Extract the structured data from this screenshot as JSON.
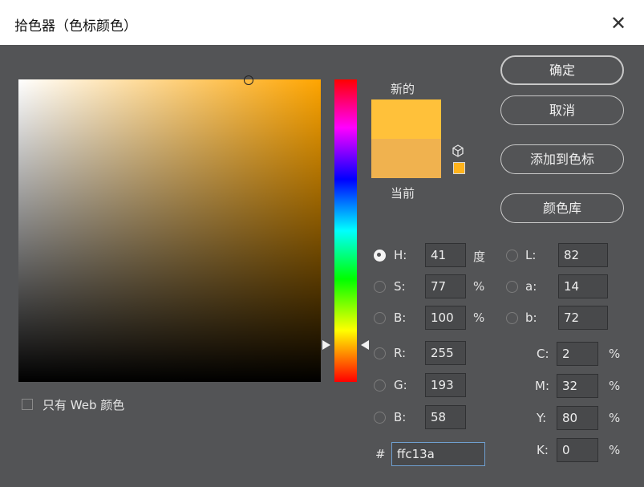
{
  "window": {
    "title": "拾色器（色标颜色）",
    "close_glyph": "✕"
  },
  "swatch": {
    "new_label": "新的",
    "current_label": "当前",
    "new_color": "#ffc13a",
    "current_color": "#f0b24f",
    "web_safe_color": "#ffb31c",
    "icon": "cube-icon"
  },
  "buttons": {
    "ok": "确定",
    "cancel": "取消",
    "add_to_swatches": "添加到色标",
    "color_libraries": "颜色库"
  },
  "hsb": [
    {
      "label": "H:",
      "value": "41",
      "unit": "度",
      "selected": true
    },
    {
      "label": "S:",
      "value": "77",
      "unit": "%",
      "selected": false
    },
    {
      "label": "B:",
      "value": "100",
      "unit": "%",
      "selected": false
    }
  ],
  "rgb": [
    {
      "label": "R:",
      "value": "255"
    },
    {
      "label": "G:",
      "value": "193"
    },
    {
      "label": "B:",
      "value": "58"
    }
  ],
  "lab": [
    {
      "label": "L:",
      "value": "82"
    },
    {
      "label": "a:",
      "value": "14"
    },
    {
      "label": "b:",
      "value": "72"
    }
  ],
  "cmyk": [
    {
      "label": "C:",
      "value": "2",
      "unit": "%"
    },
    {
      "label": "M:",
      "value": "32",
      "unit": "%"
    },
    {
      "label": "Y:",
      "value": "80",
      "unit": "%"
    },
    {
      "label": "K:",
      "value": "0",
      "unit": "%"
    }
  ],
  "hex": {
    "label": "#",
    "value": "ffc13a"
  },
  "web_only": {
    "label": "只有 Web 颜色",
    "checked": false
  },
  "colors": {
    "field_hue": "#ffa500",
    "panel_bg": "#535456"
  }
}
